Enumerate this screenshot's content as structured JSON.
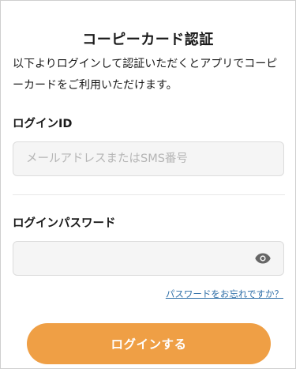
{
  "page": {
    "title": "コーピーカード認証",
    "description": "以下よりログインして認証いただくとアプリでコーピーカードをご利用いただけます。"
  },
  "form": {
    "login_id": {
      "label": "ログインID",
      "placeholder": "メールアドレスまたはSMS番号",
      "value": ""
    },
    "password": {
      "label": "ログインパスワード",
      "placeholder": "",
      "value": "",
      "toggle_icon": "eye-icon"
    },
    "forgot_password_link": "パスワードをお忘れですか？",
    "submit_label": "ログインする"
  },
  "colors": {
    "accent": "#ef9f45",
    "link": "#2f6fa8",
    "input_background": "#f5f5f5"
  }
}
